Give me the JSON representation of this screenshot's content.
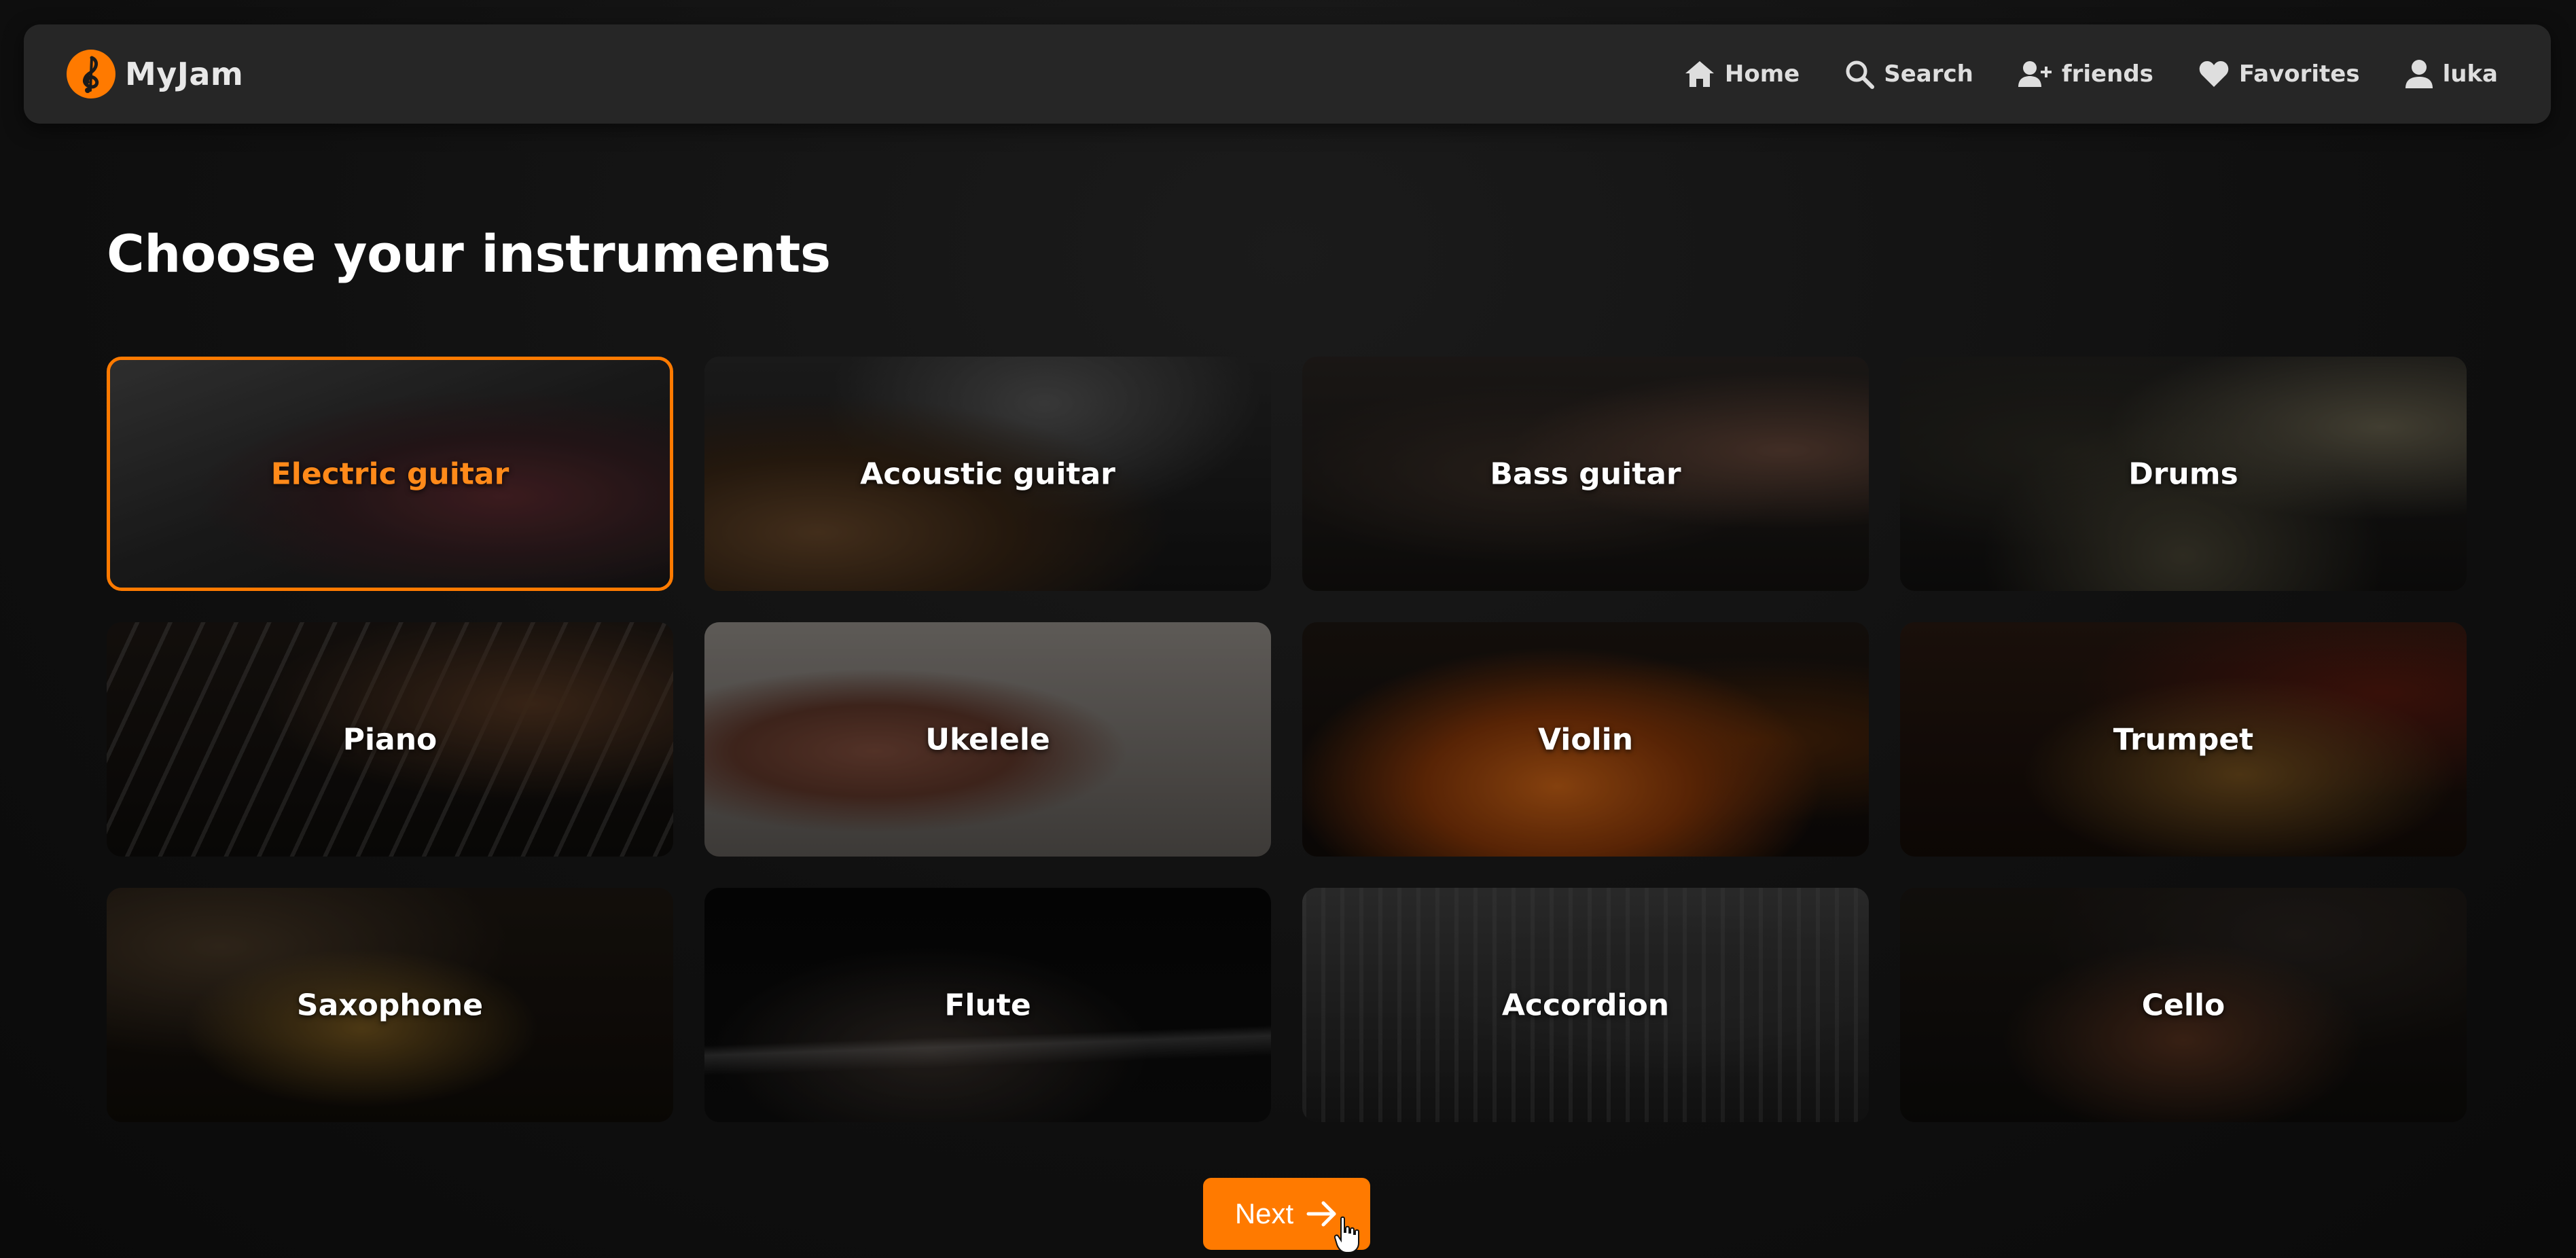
{
  "app": {
    "name": "MyJam",
    "accent_color": "#ff7a00",
    "logo_icon": "treble-clef-icon"
  },
  "nav": {
    "items": [
      {
        "label": "Home",
        "icon": "home-icon"
      },
      {
        "label": "Search",
        "icon": "search-icon"
      },
      {
        "label": "friends",
        "icon": "add-user-icon"
      },
      {
        "label": "Favorites",
        "icon": "heart-icon"
      },
      {
        "label": "luka",
        "icon": "user-icon"
      }
    ]
  },
  "main": {
    "title": "Choose your instruments",
    "instruments": [
      {
        "label": "Electric guitar",
        "selected": true
      },
      {
        "label": "Acoustic guitar",
        "selected": false
      },
      {
        "label": "Bass guitar",
        "selected": false
      },
      {
        "label": "Drums",
        "selected": false
      },
      {
        "label": "Piano",
        "selected": false
      },
      {
        "label": "Ukelele",
        "selected": false
      },
      {
        "label": "Violin",
        "selected": false
      },
      {
        "label": "Trumpet",
        "selected": false
      },
      {
        "label": "Saxophone",
        "selected": false
      },
      {
        "label": "Flute",
        "selected": false
      },
      {
        "label": "Accordion",
        "selected": false
      },
      {
        "label": "Cello",
        "selected": false
      }
    ],
    "next_label": "Next"
  }
}
